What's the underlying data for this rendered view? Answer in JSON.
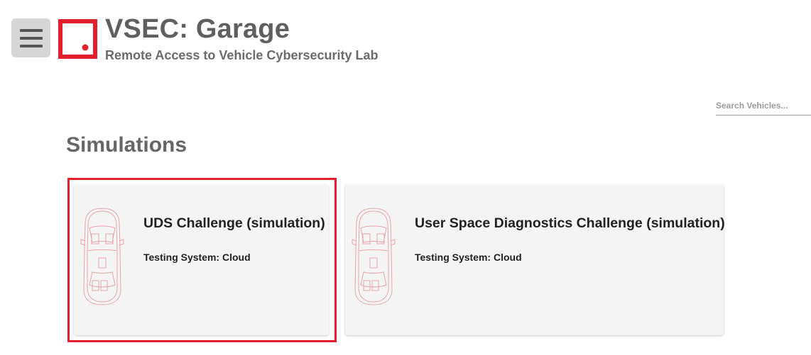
{
  "header": {
    "menu_icon": "hamburger-menu-icon",
    "title": "VSEC: Garage",
    "subtitle": "Remote Access to Vehicle Cybersecurity Lab"
  },
  "colors": {
    "brand_red": "#e5202e",
    "title_gray": "#5f5f5f",
    "card_bg": "#f4f4f4",
    "car_outline": "#e8a3ab"
  },
  "search": {
    "placeholder": "Search Vehicles...",
    "value": ""
  },
  "section": {
    "title": "Simulations"
  },
  "cards": [
    {
      "title": "UDS Challenge (simulation)",
      "system": "Testing System: Cloud",
      "icon": "car-outline-icon",
      "selected": true
    },
    {
      "title": "User Space Diagnostics Challenge (simulation)",
      "system": "Testing System: Cloud",
      "icon": "car-outline-icon",
      "selected": false
    }
  ]
}
